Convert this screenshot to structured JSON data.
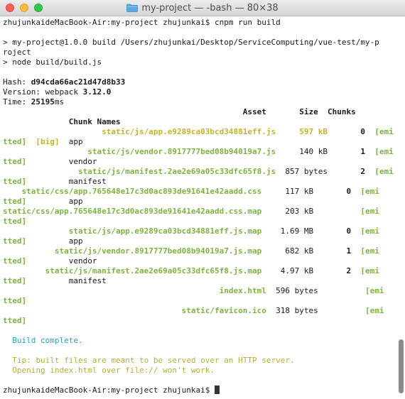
{
  "window": {
    "title": "my-project — -bash — 80×38"
  },
  "lines": [
    [
      {
        "t": "zhujunkaideMacBook-Air:my-project zhujunkai$ cnpm run build"
      }
    ],
    [
      {
        "t": ""
      }
    ],
    [
      {
        "t": "> my-project@1.0.0 build /Users/zhujunkai/Desktop/ServiceComputing/vue-test/my-p"
      }
    ],
    [
      {
        "t": "roject"
      }
    ],
    [
      {
        "t": "> node build/build.js"
      }
    ],
    [
      {
        "t": ""
      }
    ],
    [
      {
        "t": "Hash: "
      },
      {
        "t": "d94cda66ac21d47d8b33",
        "c": "b"
      }
    ],
    [
      {
        "t": "Version: webpack "
      },
      {
        "t": "3.12.0",
        "c": "b"
      }
    ],
    [
      {
        "t": "Time: "
      },
      {
        "t": "25195",
        "c": "b"
      },
      {
        "t": "ms"
      }
    ],
    [
      {
        "t": "                                                   Asset       Size  Chunks",
        "c": "b"
      }
    ],
    [
      {
        "t": "              Chunk Names",
        "c": "b"
      }
    ],
    [
      {
        "t": "                     static/js/app.e9289ca03bcd34881eff.js",
        "c": "yellow"
      },
      {
        "t": "     "
      },
      {
        "t": "597 kB",
        "c": "yellow"
      },
      {
        "t": "       "
      },
      {
        "t": "0",
        "c": "b"
      },
      {
        "t": "  "
      },
      {
        "t": "[emi",
        "c": "green"
      }
    ],
    [
      {
        "t": "tted]",
        "c": "green"
      },
      {
        "t": "  "
      },
      {
        "t": "[big]",
        "c": "yellow"
      },
      {
        "t": "  app"
      }
    ],
    [
      {
        "t": "                  static/js/vendor.8917777bed08b94019a7.js",
        "c": "green"
      },
      {
        "t": "     140 kB       "
      },
      {
        "t": "1",
        "c": "b"
      },
      {
        "t": "  "
      },
      {
        "t": "[emi",
        "c": "green"
      }
    ],
    [
      {
        "t": "tted]",
        "c": "green"
      },
      {
        "t": "         vendor"
      }
    ],
    [
      {
        "t": "                static/js/manifest.2ae2e69a05c33dfc65f8.js",
        "c": "green"
      },
      {
        "t": "  857 bytes       "
      },
      {
        "t": "2",
        "c": "b"
      },
      {
        "t": "  "
      },
      {
        "t": "[emi",
        "c": "green"
      }
    ],
    [
      {
        "t": "tted]",
        "c": "green"
      },
      {
        "t": "         manifest"
      }
    ],
    [
      {
        "t": "    static/css/app.765648e17c3d0ac893de91641e42aadd.css",
        "c": "green"
      },
      {
        "t": "     117 kB       "
      },
      {
        "t": "0",
        "c": "b"
      },
      {
        "t": "  "
      },
      {
        "t": "[emi",
        "c": "green"
      }
    ],
    [
      {
        "t": "tted]",
        "c": "green"
      },
      {
        "t": "         app"
      }
    ],
    [
      {
        "t": "static/css/app.765648e17c3d0ac893de91641e42aadd.css.map",
        "c": "green"
      },
      {
        "t": "     203 kB          "
      },
      {
        "t": "[emi",
        "c": "green"
      }
    ],
    [
      {
        "t": "tted]",
        "c": "green"
      }
    ],
    [
      {
        "t": "              static/js/app.e9289ca03bcd34881eff.js.map",
        "c": "green"
      },
      {
        "t": "    1.69 MB       "
      },
      {
        "t": "0",
        "c": "b"
      },
      {
        "t": "  "
      },
      {
        "t": "[emi",
        "c": "green"
      }
    ],
    [
      {
        "t": "tted]",
        "c": "green"
      },
      {
        "t": "         app"
      }
    ],
    [
      {
        "t": "           static/js/vendor.8917777bed08b94019a7.js.map",
        "c": "green"
      },
      {
        "t": "     682 kB       "
      },
      {
        "t": "1",
        "c": "b"
      },
      {
        "t": "  "
      },
      {
        "t": "[emi",
        "c": "green"
      }
    ],
    [
      {
        "t": "tted]",
        "c": "green"
      },
      {
        "t": "         vendor"
      }
    ],
    [
      {
        "t": "         static/js/manifest.2ae2e69a05c33dfc65f8.js.map",
        "c": "green"
      },
      {
        "t": "    4.97 kB       "
      },
      {
        "t": "2",
        "c": "b"
      },
      {
        "t": "  "
      },
      {
        "t": "[emi",
        "c": "green"
      }
    ],
    [
      {
        "t": "tted]",
        "c": "green"
      },
      {
        "t": "         manifest"
      }
    ],
    [
      {
        "t": "                                              index.html",
        "c": "green"
      },
      {
        "t": "  596 bytes          "
      },
      {
        "t": "[emi",
        "c": "green"
      }
    ],
    [
      {
        "t": "tted]",
        "c": "green"
      }
    ],
    [
      {
        "t": "                                      static/favicon.ico",
        "c": "green"
      },
      {
        "t": "  318 bytes          "
      },
      {
        "t": "[emi",
        "c": "green"
      }
    ],
    [
      {
        "t": "tted]",
        "c": "green"
      }
    ],
    [
      {
        "t": ""
      }
    ],
    [
      {
        "t": "  Build complete.",
        "c": "cyan"
      }
    ],
    [
      {
        "t": ""
      }
    ],
    [
      {
        "t": "  Tip: built files are meant to be served over an HTTP server.",
        "c": "olive"
      }
    ],
    [
      {
        "t": "  Opening index.html over file:// won't work.",
        "c": "olive"
      }
    ],
    [
      {
        "t": ""
      }
    ],
    [
      {
        "t": "zhujunkaideMacBook-Air:my-project zhujunkai$ "
      },
      {
        "cursor": true
      }
    ]
  ],
  "colors": {
    "asset_green": "#7cb342",
    "big_yellow": "#c3b330",
    "build_complete_cyan": "#2aa1b3",
    "tip_olive": "#b3b03a",
    "close": "#fc605b",
    "minimize": "#fdbc40",
    "maximize": "#34c84a"
  },
  "icons": [
    "close-button",
    "minimize-button",
    "maximize-button",
    "folder-icon",
    "text-cursor"
  ]
}
